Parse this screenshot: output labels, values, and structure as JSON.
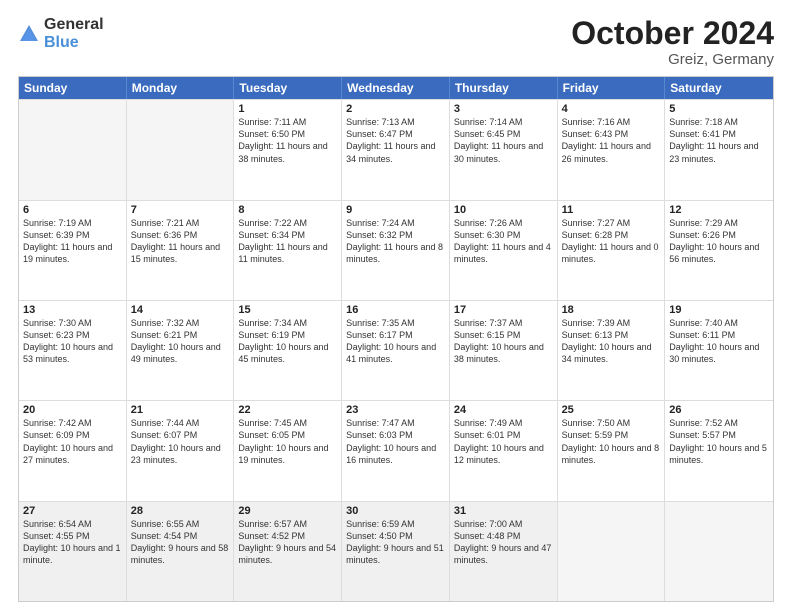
{
  "logo": {
    "line1": "General",
    "line2": "Blue"
  },
  "title": "October 2024",
  "subtitle": "Greiz, Germany",
  "days": [
    "Sunday",
    "Monday",
    "Tuesday",
    "Wednesday",
    "Thursday",
    "Friday",
    "Saturday"
  ],
  "rows": [
    [
      {
        "day": "",
        "empty": true
      },
      {
        "day": "",
        "empty": true
      },
      {
        "day": "1",
        "sunrise": "Sunrise: 7:11 AM",
        "sunset": "Sunset: 6:50 PM",
        "daylight": "Daylight: 11 hours and 38 minutes."
      },
      {
        "day": "2",
        "sunrise": "Sunrise: 7:13 AM",
        "sunset": "Sunset: 6:47 PM",
        "daylight": "Daylight: 11 hours and 34 minutes."
      },
      {
        "day": "3",
        "sunrise": "Sunrise: 7:14 AM",
        "sunset": "Sunset: 6:45 PM",
        "daylight": "Daylight: 11 hours and 30 minutes."
      },
      {
        "day": "4",
        "sunrise": "Sunrise: 7:16 AM",
        "sunset": "Sunset: 6:43 PM",
        "daylight": "Daylight: 11 hours and 26 minutes."
      },
      {
        "day": "5",
        "sunrise": "Sunrise: 7:18 AM",
        "sunset": "Sunset: 6:41 PM",
        "daylight": "Daylight: 11 hours and 23 minutes."
      }
    ],
    [
      {
        "day": "6",
        "sunrise": "Sunrise: 7:19 AM",
        "sunset": "Sunset: 6:39 PM",
        "daylight": "Daylight: 11 hours and 19 minutes."
      },
      {
        "day": "7",
        "sunrise": "Sunrise: 7:21 AM",
        "sunset": "Sunset: 6:36 PM",
        "daylight": "Daylight: 11 hours and 15 minutes."
      },
      {
        "day": "8",
        "sunrise": "Sunrise: 7:22 AM",
        "sunset": "Sunset: 6:34 PM",
        "daylight": "Daylight: 11 hours and 11 minutes."
      },
      {
        "day": "9",
        "sunrise": "Sunrise: 7:24 AM",
        "sunset": "Sunset: 6:32 PM",
        "daylight": "Daylight: 11 hours and 8 minutes."
      },
      {
        "day": "10",
        "sunrise": "Sunrise: 7:26 AM",
        "sunset": "Sunset: 6:30 PM",
        "daylight": "Daylight: 11 hours and 4 minutes."
      },
      {
        "day": "11",
        "sunrise": "Sunrise: 7:27 AM",
        "sunset": "Sunset: 6:28 PM",
        "daylight": "Daylight: 11 hours and 0 minutes."
      },
      {
        "day": "12",
        "sunrise": "Sunrise: 7:29 AM",
        "sunset": "Sunset: 6:26 PM",
        "daylight": "Daylight: 10 hours and 56 minutes."
      }
    ],
    [
      {
        "day": "13",
        "sunrise": "Sunrise: 7:30 AM",
        "sunset": "Sunset: 6:23 PM",
        "daylight": "Daylight: 10 hours and 53 minutes."
      },
      {
        "day": "14",
        "sunrise": "Sunrise: 7:32 AM",
        "sunset": "Sunset: 6:21 PM",
        "daylight": "Daylight: 10 hours and 49 minutes."
      },
      {
        "day": "15",
        "sunrise": "Sunrise: 7:34 AM",
        "sunset": "Sunset: 6:19 PM",
        "daylight": "Daylight: 10 hours and 45 minutes."
      },
      {
        "day": "16",
        "sunrise": "Sunrise: 7:35 AM",
        "sunset": "Sunset: 6:17 PM",
        "daylight": "Daylight: 10 hours and 41 minutes."
      },
      {
        "day": "17",
        "sunrise": "Sunrise: 7:37 AM",
        "sunset": "Sunset: 6:15 PM",
        "daylight": "Daylight: 10 hours and 38 minutes."
      },
      {
        "day": "18",
        "sunrise": "Sunrise: 7:39 AM",
        "sunset": "Sunset: 6:13 PM",
        "daylight": "Daylight: 10 hours and 34 minutes."
      },
      {
        "day": "19",
        "sunrise": "Sunrise: 7:40 AM",
        "sunset": "Sunset: 6:11 PM",
        "daylight": "Daylight: 10 hours and 30 minutes."
      }
    ],
    [
      {
        "day": "20",
        "sunrise": "Sunrise: 7:42 AM",
        "sunset": "Sunset: 6:09 PM",
        "daylight": "Daylight: 10 hours and 27 minutes."
      },
      {
        "day": "21",
        "sunrise": "Sunrise: 7:44 AM",
        "sunset": "Sunset: 6:07 PM",
        "daylight": "Daylight: 10 hours and 23 minutes."
      },
      {
        "day": "22",
        "sunrise": "Sunrise: 7:45 AM",
        "sunset": "Sunset: 6:05 PM",
        "daylight": "Daylight: 10 hours and 19 minutes."
      },
      {
        "day": "23",
        "sunrise": "Sunrise: 7:47 AM",
        "sunset": "Sunset: 6:03 PM",
        "daylight": "Daylight: 10 hours and 16 minutes."
      },
      {
        "day": "24",
        "sunrise": "Sunrise: 7:49 AM",
        "sunset": "Sunset: 6:01 PM",
        "daylight": "Daylight: 10 hours and 12 minutes."
      },
      {
        "day": "25",
        "sunrise": "Sunrise: 7:50 AM",
        "sunset": "Sunset: 5:59 PM",
        "daylight": "Daylight: 10 hours and 8 minutes."
      },
      {
        "day": "26",
        "sunrise": "Sunrise: 7:52 AM",
        "sunset": "Sunset: 5:57 PM",
        "daylight": "Daylight: 10 hours and 5 minutes."
      }
    ],
    [
      {
        "day": "27",
        "sunrise": "Sunrise: 6:54 AM",
        "sunset": "Sunset: 4:55 PM",
        "daylight": "Daylight: 10 hours and 1 minute."
      },
      {
        "day": "28",
        "sunrise": "Sunrise: 6:55 AM",
        "sunset": "Sunset: 4:54 PM",
        "daylight": "Daylight: 9 hours and 58 minutes."
      },
      {
        "day": "29",
        "sunrise": "Sunrise: 6:57 AM",
        "sunset": "Sunset: 4:52 PM",
        "daylight": "Daylight: 9 hours and 54 minutes."
      },
      {
        "day": "30",
        "sunrise": "Sunrise: 6:59 AM",
        "sunset": "Sunset: 4:50 PM",
        "daylight": "Daylight: 9 hours and 51 minutes."
      },
      {
        "day": "31",
        "sunrise": "Sunrise: 7:00 AM",
        "sunset": "Sunset: 4:48 PM",
        "daylight": "Daylight: 9 hours and 47 minutes."
      },
      {
        "day": "",
        "empty": true
      },
      {
        "day": "",
        "empty": true
      }
    ]
  ]
}
